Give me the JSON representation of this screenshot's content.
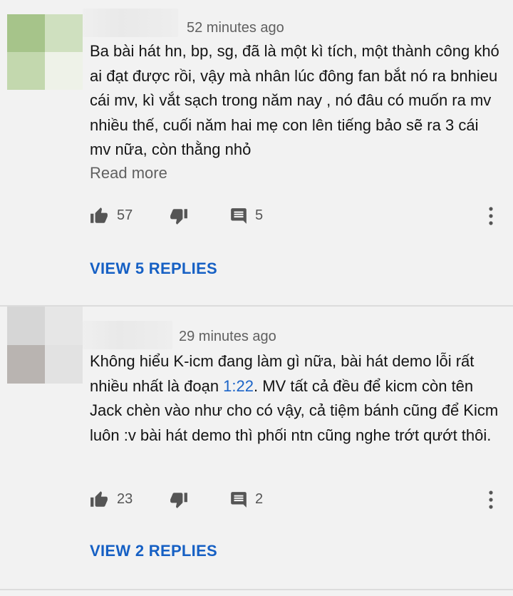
{
  "comments": [
    {
      "time": "52 minutes ago",
      "text": "Ba bài hát hn, bp, sg, đã là một kì tích, một thành công khó ai đạt được rồi, vậy mà nhân lúc đông fan bắt nó ra bnhieu cái mv, kì vắt sạch trong năm nay , nó đâu có muốn ra mv nhiều thế, cuối năm hai mẹ con lên tiếng bảo sẽ ra 3 cái mv nữa, còn thằng nhỏ",
      "read_more": "Read more",
      "likes": "57",
      "replies_count": "5",
      "view_replies": "VIEW 5 REPLIES"
    },
    {
      "time": "29 minutes ago",
      "text_before": "Không hiểu K-icm đang làm gì nữa, bài hát demo lỗi rất nhiều nhất là đoạn ",
      "timestamp_link": "1:22",
      "text_after": ". MV tất cả đều để kicm còn tên Jack chèn vào như cho có vậy, cả tiệm bánh cũng để Kicm luôn :v bài hát demo thì phối ntn cũng nghe trớt qướt thôi.",
      "likes": "23",
      "replies_count": "2",
      "view_replies": "VIEW 2 REPLIES"
    }
  ],
  "icons": {
    "like": "thumbs-up-icon",
    "dislike": "thumbs-down-icon",
    "reply": "comment-icon",
    "more": "more-vert-icon"
  },
  "colors": {
    "link": "#1b64c8",
    "view_replies": "#1660c4",
    "icon": "#555555",
    "background": "#f2f2f2"
  }
}
